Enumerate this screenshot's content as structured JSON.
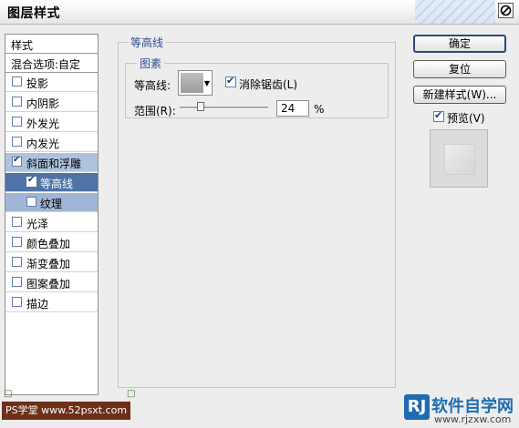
{
  "window": {
    "title": "图层样式"
  },
  "left_panel": {
    "header": "样式",
    "blend_options": "混合选项:自定",
    "items": [
      {
        "label": "投影",
        "checked": false
      },
      {
        "label": "内阴影",
        "checked": false
      },
      {
        "label": "外发光",
        "checked": false
      },
      {
        "label": "内发光",
        "checked": false
      },
      {
        "label": "斜面和浮雕",
        "checked": true
      },
      {
        "label": "等高线",
        "checked": true
      },
      {
        "label": "纹理",
        "checked": false
      },
      {
        "label": "光泽",
        "checked": false
      },
      {
        "label": "颜色叠加",
        "checked": false
      },
      {
        "label": "渐变叠加",
        "checked": false
      },
      {
        "label": "图案叠加",
        "checked": false
      },
      {
        "label": "描边",
        "checked": false
      }
    ]
  },
  "contour_panel": {
    "group_title": "等高线",
    "sub_title": "图素",
    "contour_label": "等高线:",
    "anti_alias_label": "消除锯齿(L)",
    "anti_alias_checked": true,
    "range_label": "范围(R):",
    "range_value": "24",
    "range_unit": "%",
    "range_level": 24
  },
  "buttons": {
    "ok": "确定",
    "reset": "复位",
    "new_style": "新建样式(W)...",
    "preview_label": "预览(V)",
    "preview_checked": true
  },
  "watermark": {
    "left": "PS学堂 www.52psxt.com",
    "right_logo": "RJ",
    "right_text": "软件自学网",
    "right_url": "www.rjzxw.com"
  }
}
